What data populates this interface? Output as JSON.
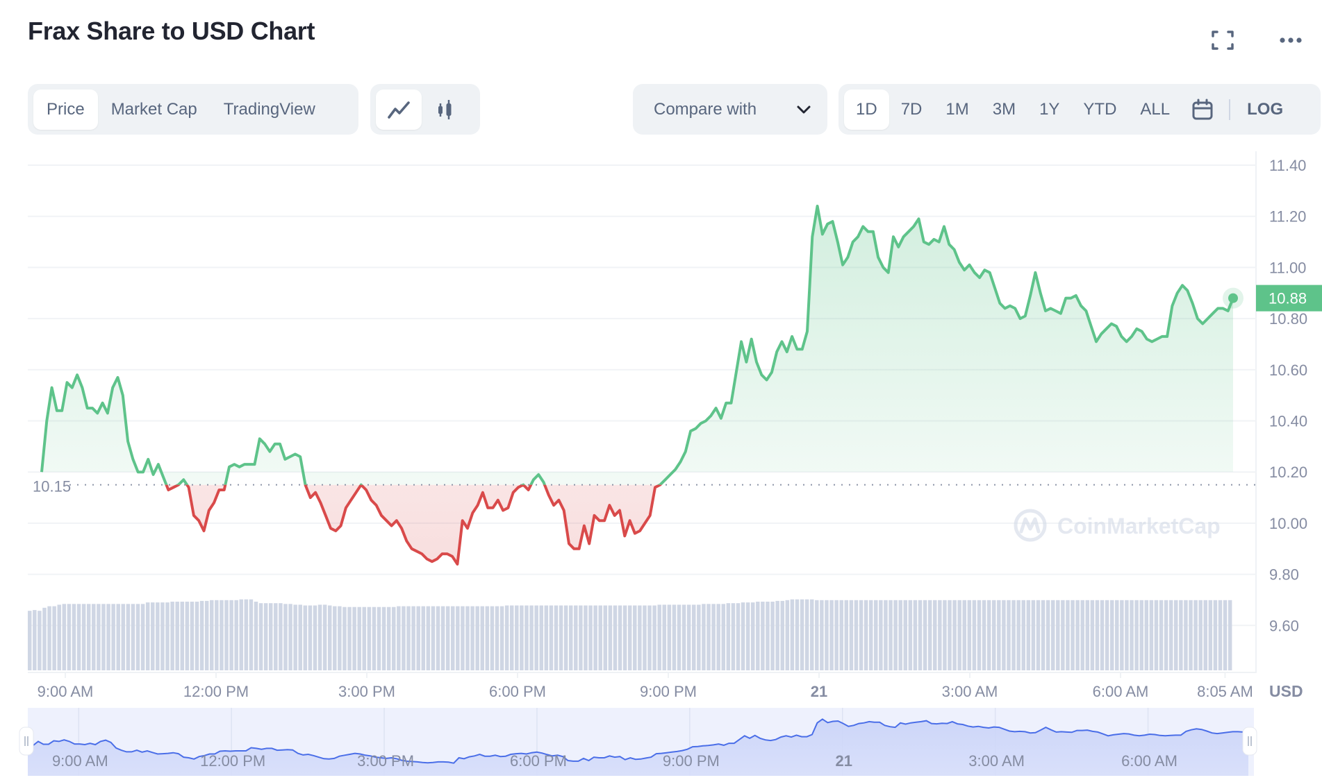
{
  "header": {
    "title": "Frax Share to USD Chart",
    "icons": [
      "fullscreen-icon",
      "more-icon"
    ]
  },
  "toolbar": {
    "data_tabs": [
      {
        "label": "Price",
        "active": true
      },
      {
        "label": "Market Cap",
        "active": false
      },
      {
        "label": "TradingView",
        "active": false
      }
    ],
    "chart_types": [
      {
        "icon": "line-chart-icon",
        "active": true
      },
      {
        "icon": "candlestick-icon",
        "active": false
      }
    ],
    "compare_label": "Compare with",
    "ranges": [
      {
        "label": "1D",
        "active": true
      },
      {
        "label": "7D",
        "active": false
      },
      {
        "label": "1M",
        "active": false
      },
      {
        "label": "3M",
        "active": false
      },
      {
        "label": "1Y",
        "active": false
      },
      {
        "label": "YTD",
        "active": false
      },
      {
        "label": "ALL",
        "active": false
      }
    ],
    "calendar_icon": "calendar-icon",
    "log_label": "LOG"
  },
  "colors": {
    "up": "#5ec38a",
    "down": "#d94a4a",
    "navigator_line": "#4a6ee8",
    "volume": "#cfd6e4",
    "text": "#58667e"
  },
  "chart_data": {
    "type": "line",
    "title": "Frax Share to USD Chart",
    "currency_label": "USD",
    "baseline_value": 10.15,
    "baseline_label": "10.15",
    "current_value": 10.88,
    "current_label": "10.88",
    "watermark": "CoinMarketCap",
    "ylim": [
      9.45,
      11.45
    ],
    "yticks": [
      "11.40",
      "11.20",
      "11.00",
      "10.80",
      "10.60",
      "10.40",
      "10.20",
      "10.00",
      "9.80",
      "9.60"
    ],
    "ytick_values": [
      11.4,
      11.2,
      11.0,
      10.8,
      10.6,
      10.4,
      10.2,
      10.0,
      9.8,
      9.6
    ],
    "xticks": [
      {
        "label": "9:00 AM",
        "hours": 0.92,
        "bold": false
      },
      {
        "label": "12:00 PM",
        "hours": 3.92,
        "bold": false
      },
      {
        "label": "3:00 PM",
        "hours": 6.92,
        "bold": false
      },
      {
        "label": "6:00 PM",
        "hours": 9.92,
        "bold": false
      },
      {
        "label": "9:00 PM",
        "hours": 12.92,
        "bold": false
      },
      {
        "label": "21",
        "hours": 15.92,
        "bold": true
      },
      {
        "label": "3:00 AM",
        "hours": 18.92,
        "bold": false
      },
      {
        "label": "6:00 AM",
        "hours": 21.92,
        "bold": false
      },
      {
        "label": "8:05 AM",
        "hours": 24.0,
        "bold": false
      }
    ],
    "navigator_xticks": [
      "9:00 AM",
      "12:00 PM",
      "3:00 PM",
      "6:00 PM",
      "9:00 PM",
      "21",
      "3:00 AM",
      "6:00 AM"
    ],
    "series": [
      {
        "name": "Price (USD)",
        "values": [
          10.2,
          10.4,
          10.53,
          10.44,
          10.44,
          10.55,
          10.53,
          10.58,
          10.53,
          10.45,
          10.45,
          10.43,
          10.47,
          10.43,
          10.53,
          10.57,
          10.5,
          10.32,
          10.25,
          10.2,
          10.2,
          10.25,
          10.19,
          10.23,
          10.18,
          10.13,
          10.14,
          10.15,
          10.17,
          10.14,
          10.03,
          10.01,
          9.97,
          10.05,
          10.08,
          10.13,
          10.13,
          10.22,
          10.23,
          10.22,
          10.23,
          10.23,
          10.23,
          10.33,
          10.31,
          10.28,
          10.31,
          10.31,
          10.25,
          10.26,
          10.27,
          10.26,
          10.15,
          10.1,
          10.12,
          10.08,
          10.03,
          9.98,
          9.97,
          9.99,
          10.06,
          10.09,
          10.12,
          10.15,
          10.13,
          10.09,
          10.07,
          10.03,
          10.01,
          9.99,
          10.01,
          9.98,
          9.93,
          9.9,
          9.89,
          9.88,
          9.86,
          9.85,
          9.86,
          9.88,
          9.88,
          9.87,
          9.84,
          10.01,
          9.98,
          10.04,
          10.07,
          10.12,
          10.06,
          10.06,
          10.09,
          10.05,
          10.06,
          10.12,
          10.14,
          10.15,
          10.13,
          10.17,
          10.19,
          10.16,
          10.11,
          10.07,
          10.09,
          10.05,
          9.92,
          9.9,
          9.9,
          9.99,
          9.92,
          10.03,
          10.01,
          10.01,
          10.07,
          10.03,
          10.05,
          9.95,
          10.01,
          9.96,
          9.97,
          10.0,
          10.03,
          10.14,
          10.15,
          10.17,
          10.19,
          10.21,
          10.24,
          10.28,
          10.36,
          10.37,
          10.39,
          10.4,
          10.42,
          10.45,
          10.41,
          10.47,
          10.47,
          10.59,
          10.71,
          10.63,
          10.72,
          10.63,
          10.58,
          10.56,
          10.59,
          10.67,
          10.71,
          10.67,
          10.73,
          10.68,
          10.68,
          10.75,
          11.12,
          11.24,
          11.13,
          11.17,
          11.18,
          11.1,
          11.01,
          11.04,
          11.1,
          11.12,
          11.16,
          11.14,
          11.14,
          11.04,
          11.0,
          10.98,
          11.12,
          11.08,
          11.12,
          11.14,
          11.16,
          11.19,
          11.1,
          11.09,
          11.11,
          11.1,
          11.16,
          11.09,
          11.07,
          11.02,
          10.99,
          11.01,
          10.98,
          10.96,
          10.99,
          10.98,
          10.92,
          10.86,
          10.84,
          10.85,
          10.84,
          10.8,
          10.81,
          10.89,
          10.98,
          10.9,
          10.83,
          10.84,
          10.83,
          10.82,
          10.88,
          10.88,
          10.89,
          10.85,
          10.83,
          10.77,
          10.71,
          10.74,
          10.76,
          10.78,
          10.77,
          10.73,
          10.71,
          10.73,
          10.76,
          10.75,
          10.72,
          10.71,
          10.72,
          10.73,
          10.73,
          10.85,
          10.9,
          10.93,
          10.91,
          10.86,
          10.8,
          10.78,
          10.8,
          10.82,
          10.84,
          10.84,
          10.83,
          10.88
        ]
      },
      {
        "name": "Volume (relative)",
        "values": [
          0.78,
          0.79,
          0.78,
          0.82,
          0.84,
          0.84,
          0.86,
          0.87,
          0.87,
          0.87,
          0.87,
          0.87,
          0.87,
          0.87,
          0.87,
          0.87,
          0.87,
          0.87,
          0.87,
          0.87,
          0.87,
          0.87,
          0.87,
          0.87,
          0.89,
          0.89,
          0.89,
          0.89,
          0.89,
          0.9,
          0.9,
          0.9,
          0.9,
          0.9,
          0.9,
          0.91,
          0.91,
          0.92,
          0.92,
          0.92,
          0.92,
          0.92,
          0.92,
          0.93,
          0.93,
          0.93,
          0.9,
          0.88,
          0.88,
          0.88,
          0.88,
          0.88,
          0.87,
          0.87,
          0.86,
          0.86,
          0.85,
          0.85,
          0.85,
          0.86,
          0.86,
          0.85,
          0.84,
          0.84,
          0.83,
          0.83,
          0.83,
          0.83,
          0.83,
          0.83,
          0.83,
          0.83,
          0.83,
          0.83,
          0.83,
          0.84,
          0.84,
          0.84,
          0.84,
          0.84,
          0.84,
          0.84,
          0.84,
          0.84,
          0.84,
          0.84,
          0.84,
          0.84,
          0.84,
          0.84,
          0.84,
          0.84,
          0.84,
          0.84,
          0.84,
          0.84,
          0.84,
          0.85,
          0.85,
          0.85,
          0.85,
          0.85,
          0.85,
          0.85,
          0.85,
          0.85,
          0.85,
          0.85,
          0.85,
          0.85,
          0.85,
          0.85,
          0.85,
          0.85,
          0.85,
          0.85,
          0.85,
          0.85,
          0.85,
          0.85,
          0.85,
          0.85,
          0.85,
          0.85,
          0.85,
          0.85,
          0.85,
          0.85,
          0.86,
          0.86,
          0.86,
          0.86,
          0.86,
          0.86,
          0.86,
          0.86,
          0.86,
          0.87,
          0.87,
          0.87,
          0.87,
          0.87,
          0.88,
          0.88,
          0.88,
          0.89,
          0.89,
          0.89,
          0.9,
          0.9,
          0.9,
          0.9,
          0.91,
          0.91,
          0.92,
          0.93,
          0.93,
          0.93,
          0.93,
          0.93,
          0.92,
          0.92,
          0.92,
          0.92,
          0.92,
          0.92,
          0.92,
          0.92,
          0.92,
          0.92,
          0.92,
          0.92,
          0.92,
          0.92,
          0.92,
          0.92,
          0.92,
          0.92,
          0.92,
          0.92,
          0.92,
          0.92,
          0.92,
          0.92,
          0.92,
          0.92,
          0.92,
          0.92,
          0.92,
          0.92,
          0.92,
          0.92,
          0.92,
          0.92,
          0.92,
          0.92,
          0.92,
          0.92,
          0.92,
          0.92,
          0.92,
          0.92,
          0.92,
          0.92,
          0.92,
          0.92,
          0.92,
          0.92,
          0.92,
          0.92,
          0.92,
          0.92,
          0.92,
          0.92,
          0.92,
          0.92,
          0.92,
          0.92,
          0.92,
          0.92,
          0.92,
          0.92,
          0.92,
          0.92,
          0.92,
          0.92,
          0.92,
          0.92,
          0.92,
          0.92,
          0.92,
          0.92,
          0.92,
          0.92,
          0.92,
          0.92,
          0.92,
          0.92,
          0.92,
          0.92,
          0.92,
          0.92,
          0.92,
          0.92,
          0.92
        ]
      }
    ],
    "grid": true,
    "legend": "none"
  }
}
